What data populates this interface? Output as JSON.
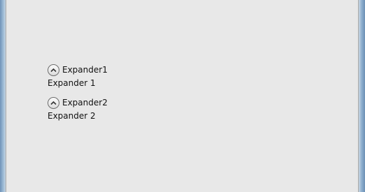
{
  "expanders": [
    {
      "header": "Expander1",
      "content": "Expander 1",
      "icon": "chevron-up-icon",
      "expanded": true
    },
    {
      "header": "Expander2",
      "content": "Expander 2",
      "icon": "chevron-up-icon",
      "expanded": true
    }
  ]
}
